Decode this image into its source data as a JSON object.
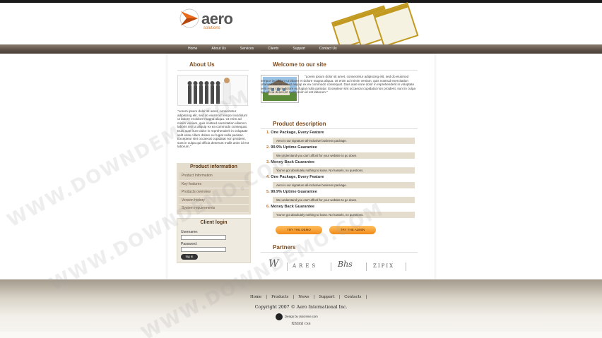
{
  "brand": {
    "name": "aero",
    "tagline": "solutions"
  },
  "nav": [
    "Home",
    "About Us",
    "Services",
    "Clients",
    "Support",
    "Contact Us"
  ],
  "about": {
    "heading": "About Us",
    "text": "\"Lorem ipsum dolor sit amet, consectetur adipiscing elit, sed do eiusmod tempor incididunt ut labore et dolore magna aliqua. Ut enim ad minim veniam, quis nostrud exercitation ullamco laboris nisi ut aliquip ex ea commodo consequat. Duis aute irure dolor in reprehenderit in voluptate velit esse cillum dolore eu fugiat nulla pariatur. Excepteur sint occaecat cupidatat non proident, sunt in culpa qui officia deserunt mollit anim id est laborum.\""
  },
  "product_info": {
    "heading": "Product information",
    "items": [
      "Product Information",
      "Key features",
      "Products overview",
      "Version history",
      "System requirements"
    ]
  },
  "login": {
    "heading": "Client login",
    "username_label": "Username:",
    "password_label": "Password:",
    "button": "log in"
  },
  "welcome": {
    "heading": "Welcome to our site",
    "text": "\"Lorem ipsum dolor sit amet, consectetur adipiscing elit, sed do eiusmod tempor incididunt ut labore et dolore magna aliqua. Ut enim ad minim veniam, quis nostrud exercitation ullamco laboris nisi ut aliquip ex ea commodo consequat. Duis aute irure dolor in reprehenderit in voluptate velit esse cillum dolore eu fugiat nulla pariatur. Excepteur sint occaecat cupidatat non proident, sunt in culpa qui officia deserunt mollit anim id est laborum.\""
  },
  "product_description": {
    "heading": "Product description",
    "items": [
      {
        "num": "1.",
        "title": "One Package, Every Feature",
        "desc": "Aero is our signature all-inclusive business package."
      },
      {
        "num": "2.",
        "title": "99.9% Uptime Guarantee",
        "desc": "We understand you can't afford for your website to go down."
      },
      {
        "num": "3.",
        "title": "Money Back Guarantee",
        "desc": "You've got absolutely nothing to loose. No hassels, no questions."
      },
      {
        "num": "4.",
        "title": "One Package, Every Feature",
        "desc": "Aero is our signature all-inclusive business package."
      },
      {
        "num": "5.",
        "title": "99.9% Uptime Guarantee",
        "desc": "We understand you can't afford for your website to go down."
      },
      {
        "num": "6.",
        "title": "Money Back Guarantee",
        "desc": "You've got absolutely nothing to loose. No hassels, no questions."
      }
    ]
  },
  "buttons": {
    "demo": "TRY THE DEMO",
    "admin": "TRY THE ADMIN"
  },
  "partners": {
    "heading": "Partners",
    "logos": [
      "W",
      "ARES",
      "Bhs",
      "ZIPIX"
    ]
  },
  "footer": {
    "links": [
      "Home",
      "Products",
      "News",
      "Support",
      "Contacts"
    ],
    "copyright": "Copyright 2007 © Aero International Inc.",
    "design": "Design by csscreme.com",
    "xhtml": "Xhtml css"
  },
  "watermark": "WWW.DOWNDEMO.COM",
  "colors": {
    "accent": "#c8701e",
    "heading": "#7a4a1e",
    "nav": "#5c5046",
    "panel": "#e4dccc"
  }
}
